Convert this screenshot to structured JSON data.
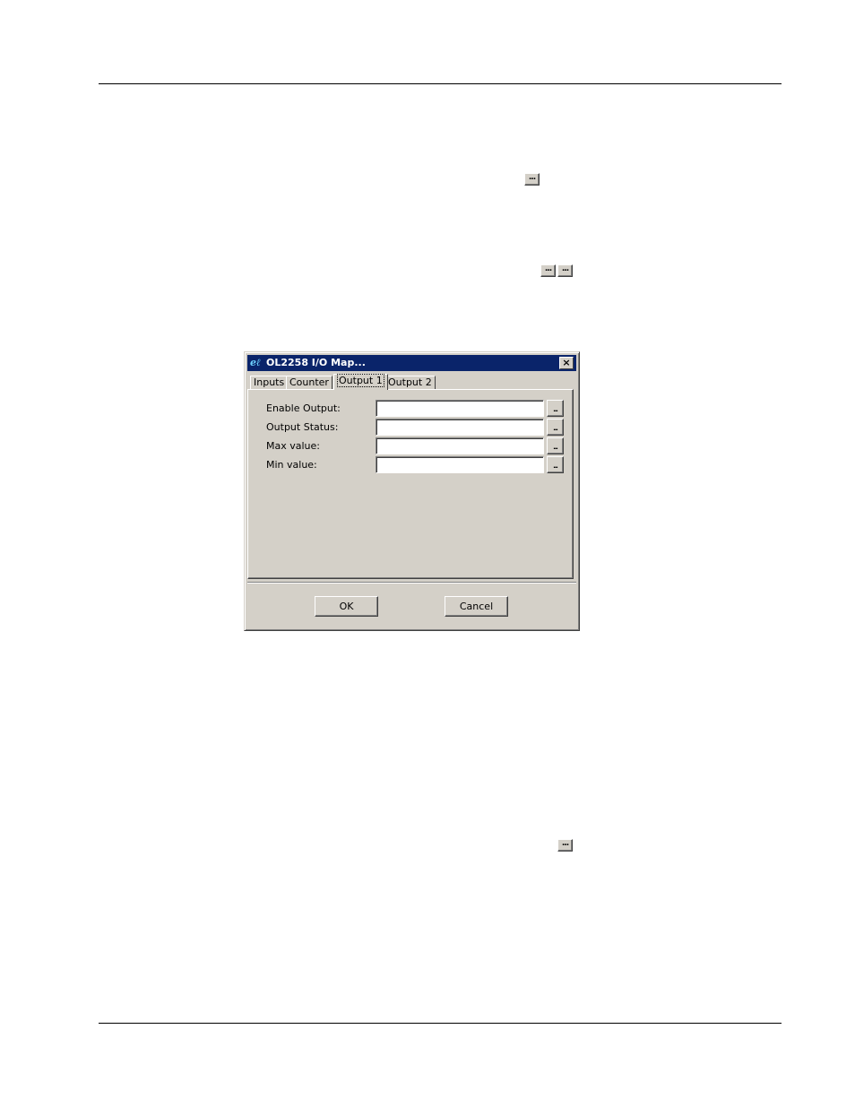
{
  "doc": {
    "inline_button_label": "..."
  },
  "dialog": {
    "title": "OL2258 I/O Map...",
    "icon_glyph": "eℓ",
    "close_glyph": "×",
    "tabs": [
      {
        "label": "Inputs"
      },
      {
        "label": "Counter"
      },
      {
        "label": "Output 1"
      },
      {
        "label": "Output 2"
      }
    ],
    "active_tab": "Output 1",
    "rows": [
      {
        "label": "Enable Output:",
        "value": "",
        "browse": "..."
      },
      {
        "label": "Output Status:",
        "value": "",
        "browse": "..."
      },
      {
        "label": "Max value:",
        "value": "",
        "browse": "..."
      },
      {
        "label": "Min value:",
        "value": "",
        "browse": "..."
      }
    ],
    "ok_label": "OK",
    "cancel_label": "Cancel"
  },
  "colors": {
    "titlebar": "#0a246a",
    "face": "#d4d0c8"
  }
}
